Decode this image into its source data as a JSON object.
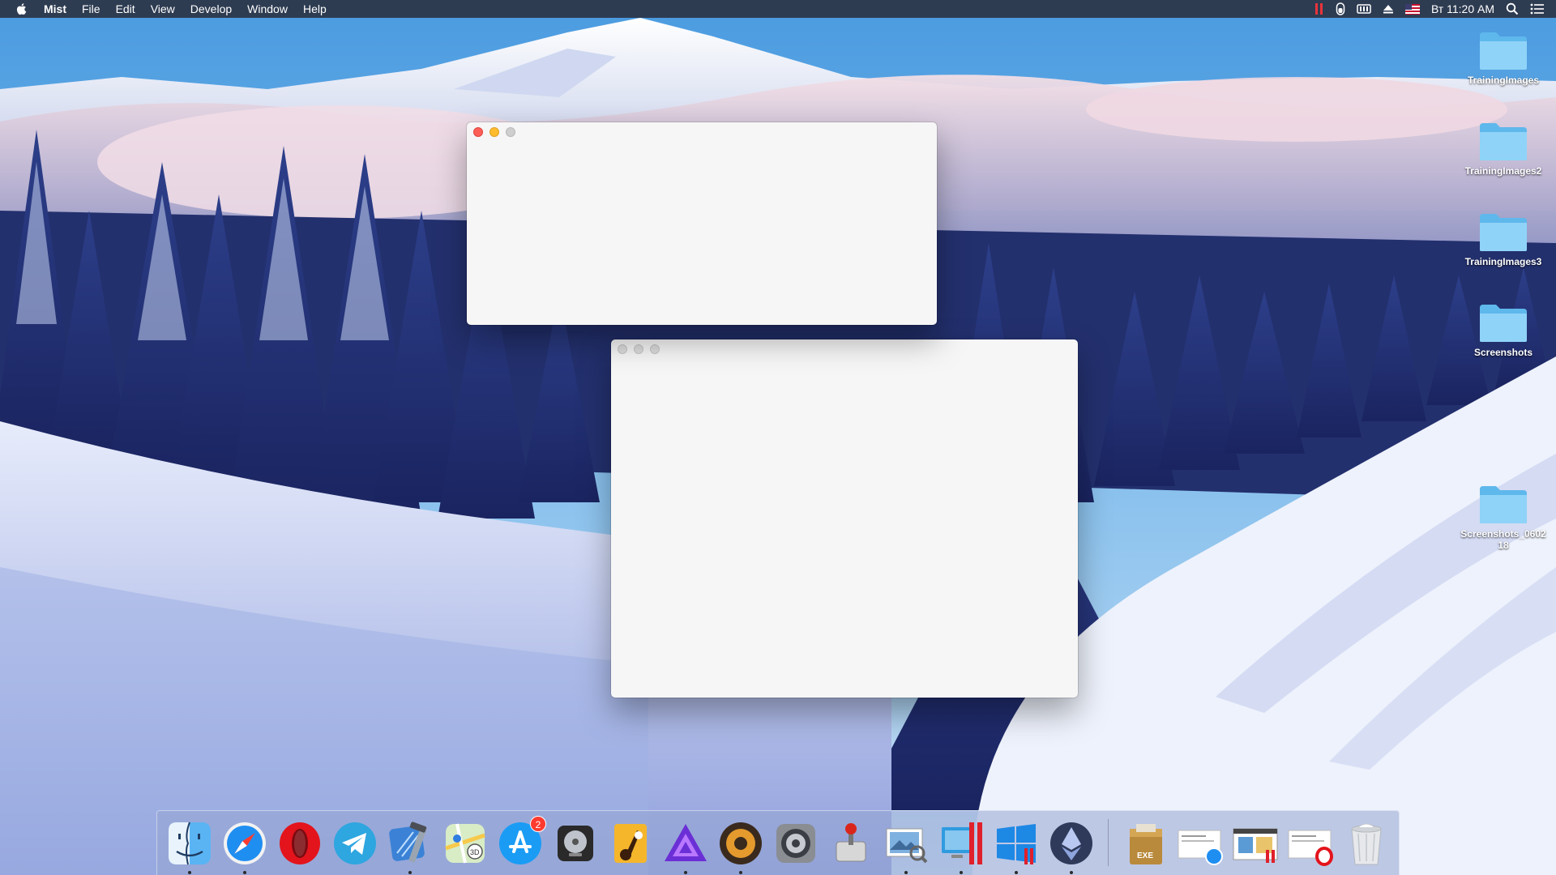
{
  "menubar": {
    "apple_icon": "apple-logo-icon",
    "app_name": "Mist",
    "menus": [
      "File",
      "Edit",
      "View",
      "Develop",
      "Window",
      "Help"
    ],
    "status_icons": [
      "parallels-icon",
      "mouse-battery-icon",
      "keyboard-icon",
      "eject-icon",
      "us-flag-input-icon"
    ],
    "clock": "Вт 11:20 AM",
    "search_icon": "spotlight-search-icon",
    "notification_icon": "notification-center-icon"
  },
  "desktop": {
    "folders": [
      {
        "label": "TrainingImages"
      },
      {
        "label": "TrainingImages2"
      },
      {
        "label": "TrainingImages3"
      },
      {
        "label": "Screenshots"
      },
      {
        "label": "Screenshots_060218"
      }
    ]
  },
  "windows": [
    {
      "name": "front-window",
      "state": "active"
    },
    {
      "name": "back-window",
      "state": "inactive"
    }
  ],
  "dock": {
    "items": [
      {
        "icon": "finder-icon",
        "running": true
      },
      {
        "icon": "safari-icon",
        "running": true
      },
      {
        "icon": "opera-icon",
        "running": false
      },
      {
        "icon": "telegram-icon",
        "running": false
      },
      {
        "icon": "xcode-icon",
        "running": true
      },
      {
        "icon": "maps-icon",
        "running": false
      },
      {
        "icon": "app-store-icon",
        "running": false,
        "badge": "2"
      },
      {
        "icon": "disk-utility-icon",
        "running": false
      },
      {
        "icon": "garageband-icon",
        "running": false
      },
      {
        "icon": "affinity-photo-icon",
        "running": true
      },
      {
        "icon": "speaker-app-icon",
        "running": true
      },
      {
        "icon": "system-preferences-icon",
        "running": false
      },
      {
        "icon": "joystick-app-icon",
        "running": false
      },
      {
        "icon": "preview-icon",
        "running": true
      },
      {
        "icon": "parallels-desktop-icon",
        "running": true
      },
      {
        "icon": "windows-vm-icon",
        "running": true
      },
      {
        "icon": "ethereum-wallet-icon",
        "running": true
      },
      {
        "icon": "exe-archive-icon",
        "running": false
      },
      {
        "icon": "minimized-safari-window-icon",
        "running": false
      },
      {
        "icon": "minimized-parallels-window-icon",
        "running": false
      },
      {
        "icon": "minimized-opera-window-icon",
        "running": false
      },
      {
        "icon": "trash-icon",
        "running": false
      }
    ]
  }
}
